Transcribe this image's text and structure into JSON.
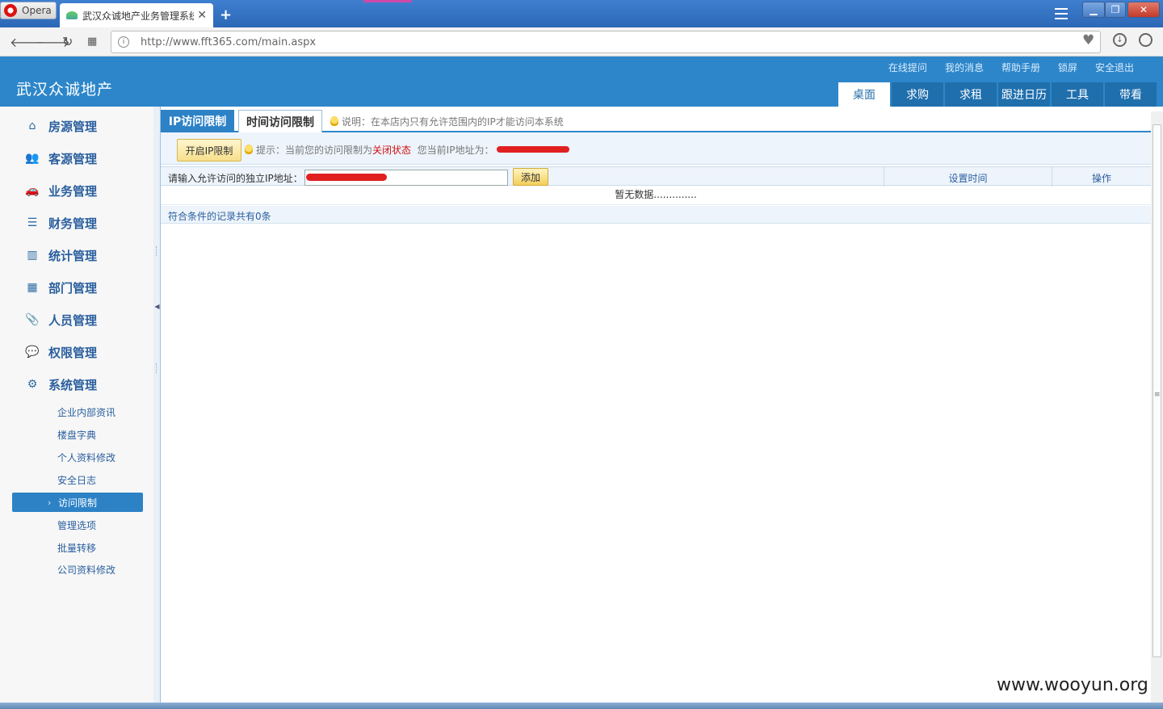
{
  "browser": {
    "menu_label": "Opera",
    "tab_title": "武汉众诚地产业务管理系统",
    "new_tab": "+",
    "url": "http://www.fft365.com/main.aspx"
  },
  "header": {
    "app_title": "武汉众诚地产",
    "top_links": [
      "在线提问",
      "我的消息",
      "帮助手册",
      "锁屏",
      "安全退出"
    ],
    "nav": [
      "桌面",
      "求购",
      "求租",
      "跟进日历",
      "工具",
      "带看"
    ]
  },
  "sidebar": {
    "items": [
      {
        "label": "房源管理",
        "icon": "home-icon"
      },
      {
        "label": "客源管理",
        "icon": "users-icon"
      },
      {
        "label": "业务管理",
        "icon": "car-icon"
      },
      {
        "label": "财务管理",
        "icon": "finance-icon"
      },
      {
        "label": "统计管理",
        "icon": "bar-chart-icon"
      },
      {
        "label": "部门管理",
        "icon": "org-icon"
      },
      {
        "label": "人员管理",
        "icon": "paperclip-icon"
      },
      {
        "label": "权限管理",
        "icon": "chat-icon"
      },
      {
        "label": "系统管理",
        "icon": "gear-icon"
      }
    ],
    "sub_items": [
      "企业内部资讯",
      "楼盘字典",
      "个人资料修改",
      "安全日志",
      "访问限制",
      "管理选项",
      "批量转移",
      "公司资料修改"
    ],
    "active_sub": "访问限制"
  },
  "content": {
    "tabs": [
      "IP访问限制",
      "时间访问限制"
    ],
    "tab_note": "说明：在本店内只有允许范围内的IP才能访问本系统",
    "open_btn": "开启IP限制",
    "tip_prefix": "提示：当前您的访问限制为",
    "tip_status": "关闭状态",
    "tip_suffix": "您当前IP地址为：",
    "ip_label": "请输入允许访问的独立IP地址：",
    "add_btn": "添加",
    "col_time": "设置时间",
    "col_action": "操作",
    "empty": "暂无数据..............",
    "footer": "符合条件的记录共有0条"
  },
  "watermark": "www.wooyun.org",
  "colors": {
    "header": "#2d86c9",
    "nav": "#1f6fad",
    "active": "#2d82c6",
    "status_closed": "#d01010"
  }
}
